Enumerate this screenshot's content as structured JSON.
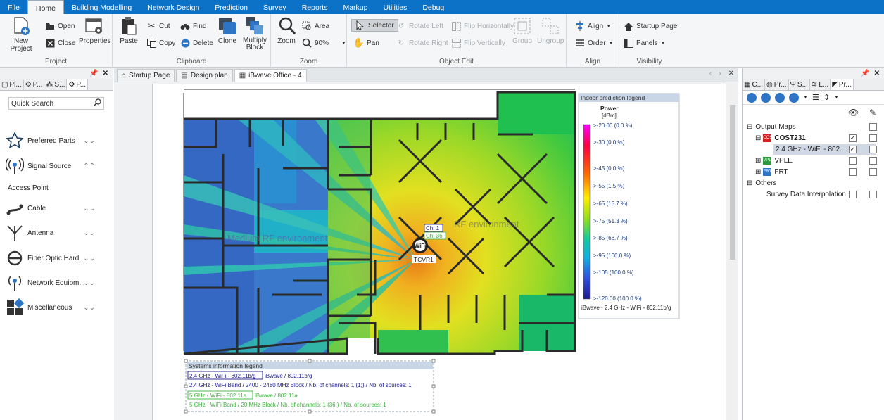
{
  "tabs": [
    "File",
    "Home",
    "Building Modelling",
    "Network Design",
    "Prediction",
    "Survey",
    "Reports",
    "Markup",
    "Utilities",
    "Debug"
  ],
  "ribbon": {
    "project": {
      "title": "Project",
      "new_project": "New Project",
      "open": "Open",
      "close": "Close",
      "properties": "Properties"
    },
    "clipboard": {
      "title": "Clipboard",
      "paste": "Paste",
      "cut": "Cut",
      "copy": "Copy",
      "find": "Find",
      "delete": "Delete",
      "clone": "Clone",
      "multiply_block": "Multiply Block"
    },
    "zoom": {
      "title": "Zoom",
      "zoom": "Zoom",
      "area": "Area",
      "level": "90%"
    },
    "object_edit": {
      "title": "Object Edit",
      "selector": "Selector",
      "pan": "Pan",
      "rotate_left": "Rotate Left",
      "rotate_right": "Rotate Right",
      "flip_horizontally": "Flip Horizontally",
      "flip_vertically": "Flip Vertically",
      "group": "Group",
      "ungroup": "Ungroup"
    },
    "align": {
      "title": "Align",
      "align": "Align",
      "order": "Order"
    },
    "visibility": {
      "title": "Visibility",
      "startup_page": "Startup Page",
      "panels": "Panels"
    }
  },
  "left_panel": {
    "tabs": [
      "Pl...",
      "P...",
      "S...",
      "P..."
    ],
    "search_placeholder": "Quick Search",
    "items": [
      "Preferred Parts",
      "Signal Source",
      "Access Point",
      "Cable",
      "Antenna",
      "Fiber Optic Hard...",
      "Network Equipm...",
      "Miscellaneous"
    ]
  },
  "doc_tabs": [
    "Startup Page",
    "Design plan",
    "iBwave Office - 4"
  ],
  "map": {
    "watermark_left": "Medium RF environment",
    "watermark_right": "RF environment",
    "ap_channel_1": "Ch: 1",
    "ap_channel_36": "Ch: 36",
    "ap_name": "TCVR1",
    "ap_icon_text": "WiFi"
  },
  "legend": {
    "title": "Indoor prediction legend",
    "quantity": "Power",
    "unit": "[dBm]",
    "entries": [
      ">-20.00 (0.0 %)",
      ">-30 (0.0 %)",
      ">-45 (0.0 %)",
      ">-55 (1.5 %)",
      ">-65 (15.7 %)",
      ">-75 (51.3 %)",
      ">-85 (68.7 %)",
      ">-95 (100.0 %)",
      ">-105 (100.0 %)",
      ">-120.00 (100.0 %)"
    ],
    "footer": "iBwave - 2.4 GHz - WiFi - 802.11b/g",
    "colors": {
      "high": "#ff00ff",
      "mid": "#ffee00",
      "low": "#1a1a8c"
    }
  },
  "systems_legend": {
    "title": "Systems information legend",
    "line1_box": "2.4 GHz - WiFi - 802.11b/g",
    "line1_rest": "iBwave / 802.11b/g",
    "line2": "2.4 GHz - WiFi Band  /  2400 - 2480 MHz Block  /  Nb. of channels: 1 (1;)  /  Nb. of sources: 1",
    "line3_box": "5 GHz - WiFi - 802.11a",
    "line3_rest": "iBwave / 802.11a",
    "line4": "5 GHz - WiFi Band  /  20 MHz Block  /  Nb. of channels: 1 (36;)  /  Nb. of sources: 1",
    "color_24": "#1a1a8c",
    "color_5": "#3cb43c"
  },
  "right_panel": {
    "tabs": [
      "C...",
      "Pr...",
      "S...",
      "L...",
      "Pr..."
    ],
    "tree": {
      "output_maps": "Output Maps",
      "cost231": "COST231",
      "cost231_child": "2.4 GHz - WiFi - 802....",
      "vple": "VPLE",
      "frt": "FRT",
      "others": "Others",
      "survey_interp": "Survey Data Interpolation"
    },
    "badges": {
      "cost231": "COST",
      "vple": "VPLE",
      "frt": "FRT"
    }
  }
}
